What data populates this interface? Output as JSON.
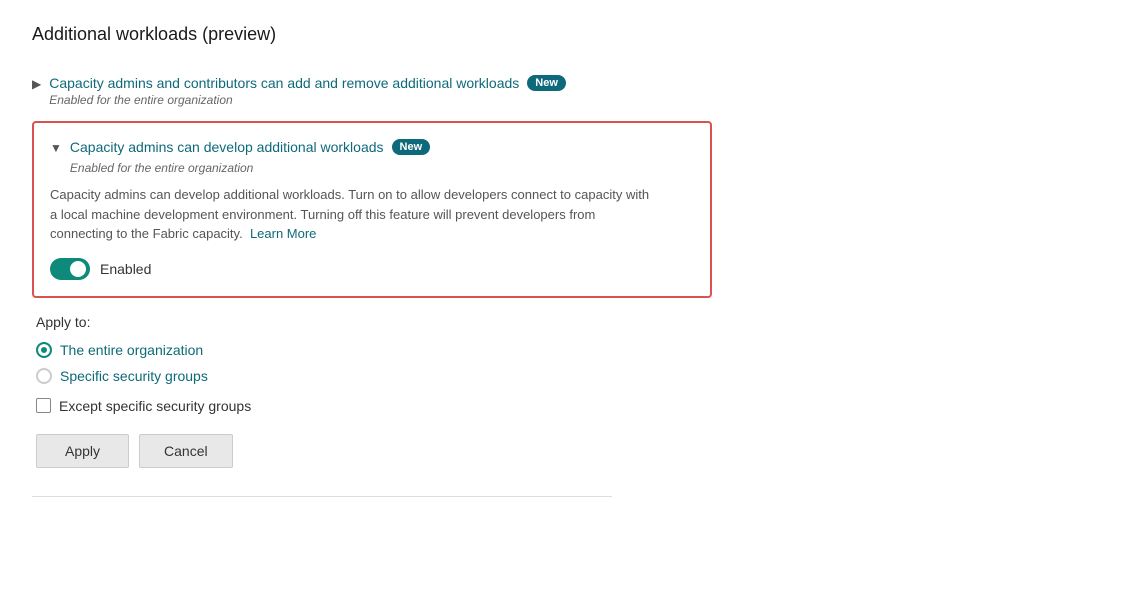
{
  "page": {
    "title": "Additional workloads (preview)"
  },
  "items": [
    {
      "id": "item1",
      "chevron": "▶",
      "title": "Capacity admins and contributors can add and remove additional workloads",
      "badge": "New",
      "subtitle": "Enabled for the entire organization",
      "expanded": false
    },
    {
      "id": "item2",
      "chevron": "▼",
      "title": "Capacity admins can develop additional workloads",
      "badge": "New",
      "subtitle": "Enabled for the entire organization",
      "expanded": true,
      "description_part1": "Capacity admins can develop additional workloads. Turn on to allow developers connect to capacity with a local machine development environment. Turning off this feature will prevent developers from connecting to the Fabric capacity.",
      "learn_more_label": "Learn More",
      "toggle_label": "Enabled",
      "toggle_checked": true
    }
  ],
  "apply_to": {
    "title": "Apply to:",
    "options": [
      {
        "id": "opt1",
        "label": "The entire organization",
        "checked": true
      },
      {
        "id": "opt2",
        "label": "Specific security groups",
        "checked": false
      }
    ],
    "checkbox": {
      "label": "Except specific security groups",
      "checked": false
    }
  },
  "buttons": {
    "apply_label": "Apply",
    "cancel_label": "Cancel"
  }
}
